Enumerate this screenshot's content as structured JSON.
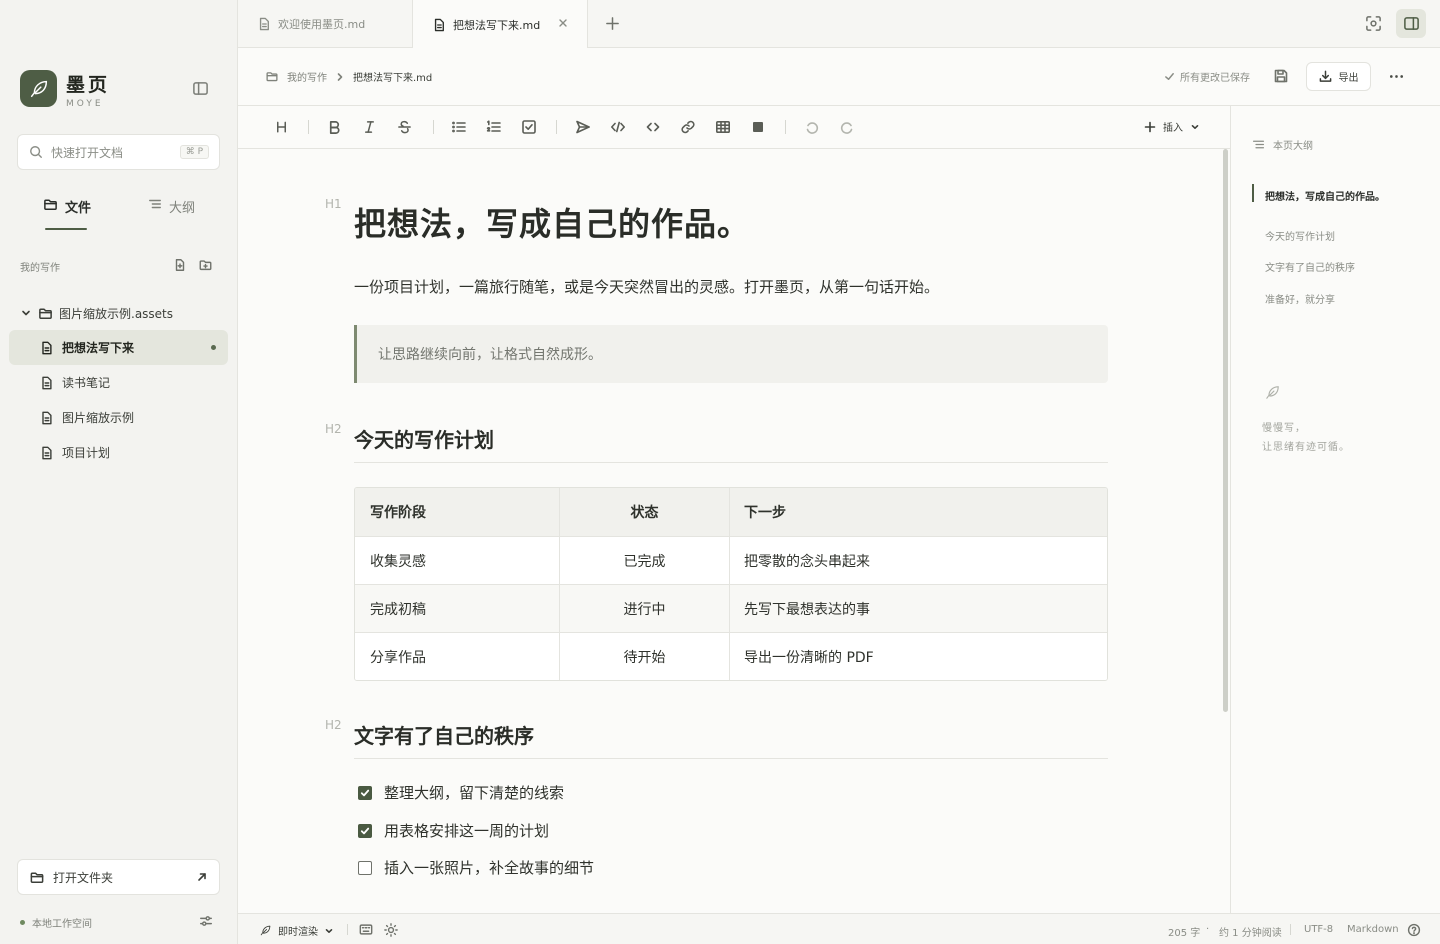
{
  "app": {
    "name": "墨页",
    "subtitle": "MOYE"
  },
  "search": {
    "placeholder": "快速打开文档",
    "shortcut": "⌘ P"
  },
  "side_tabs": [
    {
      "label": "文件",
      "icon": "folder-icon",
      "active": true
    },
    {
      "label": "大纲",
      "icon": "list-icon",
      "active": false
    }
  ],
  "workspace_section": {
    "label": "我的写作"
  },
  "tree": {
    "folder": "图片缩放示例.assets",
    "files": [
      {
        "name": "把想法写下来",
        "active": true,
        "modified": true
      },
      {
        "name": "读书笔记",
        "active": false
      },
      {
        "name": "图片缩放示例",
        "active": false
      },
      {
        "name": "项目计划",
        "active": false
      }
    ]
  },
  "open_folder": {
    "label": "打开文件夹"
  },
  "workspace": {
    "label": "本地工作空间"
  },
  "tabs": [
    {
      "label": "欢迎使用墨页.md",
      "active": false
    },
    {
      "label": "把想法写下来.md",
      "active": true
    }
  ],
  "breadcrumb": {
    "root": "我的写作",
    "current": "把想法写下来.md"
  },
  "save_status": "所有更改已保存",
  "export_label": "导出",
  "toolbar": {
    "insert_label": "插入"
  },
  "doc": {
    "h1_marker": "H1",
    "h2_marker": "H2",
    "title": "把想法，写成自己的作品。",
    "lead": "一份项目计划，一篇旅行随笔，或是今天突然冒出的灵感。打开墨页，从第一句话开始。",
    "quote": "让思路继续向前，让格式自然成形。",
    "section1": "今天的写作计划",
    "table": {
      "headers": [
        "写作阶段",
        "状态",
        "下一步"
      ],
      "rows": [
        [
          "收集灵感",
          "已完成",
          "把零散的念头串起来"
        ],
        [
          "完成初稿",
          "进行中",
          "先写下最想表达的事"
        ],
        [
          "分享作品",
          "待开始",
          "导出一份清晰的 PDF"
        ]
      ]
    },
    "section2": "文字有了自己的秩序",
    "tasks": [
      {
        "text": "整理大纲，留下清楚的线索",
        "done": true
      },
      {
        "text": "用表格安排这一周的计划",
        "done": true
      },
      {
        "text": "插入一张照片，补全故事的细节",
        "done": false
      }
    ]
  },
  "outline": {
    "title": "本页大纲",
    "items": [
      {
        "label": "把想法，写成自己的作品。",
        "active": true
      },
      {
        "label": "今天的写作计划",
        "active": false
      },
      {
        "label": "文字有了自己的秩序",
        "active": false
      },
      {
        "label": "准备好，就分享",
        "active": false
      }
    ],
    "note_line1": "慢慢写，",
    "note_line2": "让思绪有迹可循。"
  },
  "status": {
    "mode": "即时渲染",
    "words": "205 字",
    "read_time": "约 1 分钟阅读",
    "encoding": "UTF-8",
    "format": "Markdown"
  },
  "colors": {
    "accent": "#4e5d45",
    "active_bg": "#e4e6dd",
    "background": "#fbfbf9",
    "sidebar": "#f3f3f0"
  }
}
